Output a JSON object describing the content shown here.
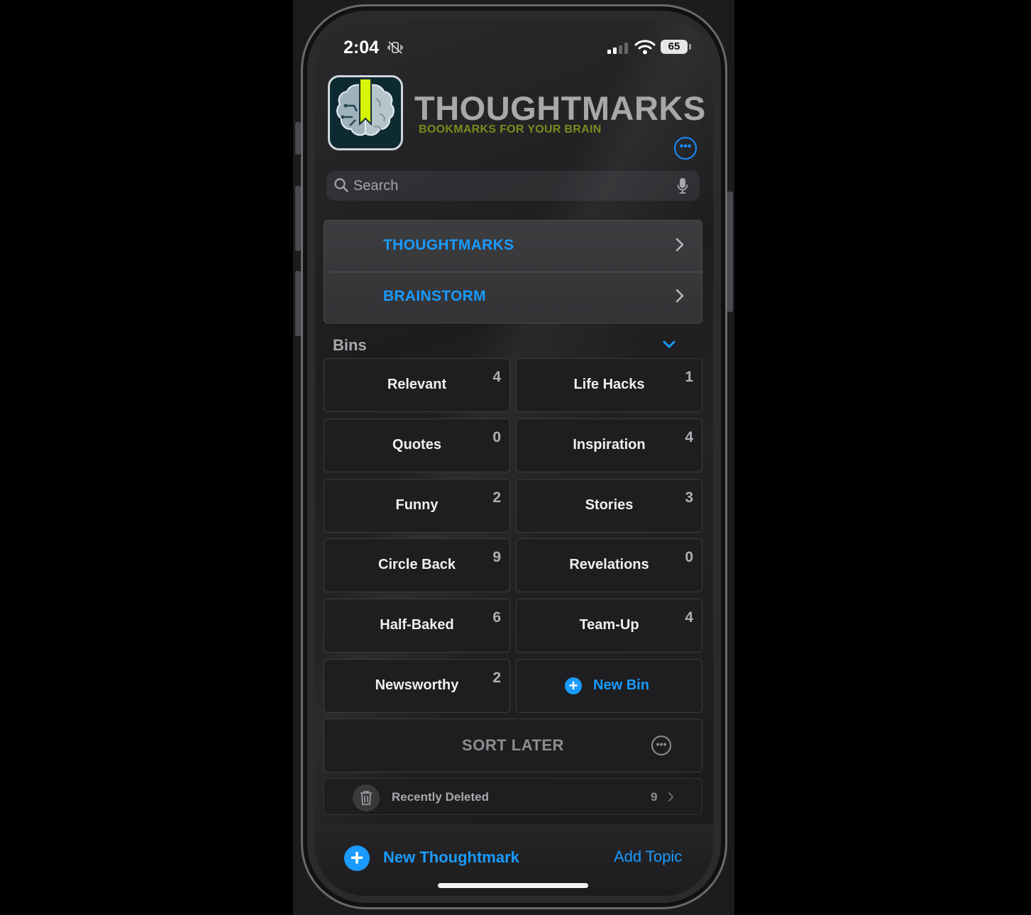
{
  "status_bar": {
    "time": "2:04",
    "vibrate_icon": "vibrate-off-icon",
    "battery": "65"
  },
  "header": {
    "title": "THOUGHTMARKS",
    "subtitle": "BOOKMARKS FOR YOUR BRAIN",
    "more_icon": "ellipsis-circle-icon"
  },
  "search": {
    "placeholder": "Search"
  },
  "topics": [
    {
      "label": "THOUGHTMARKS"
    },
    {
      "label": "BRAINSTORM"
    }
  ],
  "bins": {
    "title": "Bins",
    "items": [
      {
        "name": "Relevant",
        "count": "4"
      },
      {
        "name": "Life Hacks",
        "count": "1"
      },
      {
        "name": "Quotes",
        "count": "0"
      },
      {
        "name": "Inspiration",
        "count": "4"
      },
      {
        "name": "Funny",
        "count": "2"
      },
      {
        "name": "Stories",
        "count": "3"
      },
      {
        "name": "Circle Back",
        "count": "9"
      },
      {
        "name": "Revelations",
        "count": "0"
      },
      {
        "name": "Half-Baked",
        "count": "6"
      },
      {
        "name": "Team-Up",
        "count": "4"
      },
      {
        "name": "Newsworthy",
        "count": "2"
      }
    ],
    "new_bin_label": "New Bin"
  },
  "sort_later": {
    "label": "SORT LATER"
  },
  "recently_deleted": {
    "label": "Recently Deleted",
    "count": "9"
  },
  "toolbar": {
    "new_thoughtmark": "New Thoughtmark",
    "add_topic": "Add Topic"
  },
  "colors": {
    "accent": "#1a9bff",
    "brand_green": "#7c8a1e",
    "logo_yellow": "#d7f500"
  }
}
